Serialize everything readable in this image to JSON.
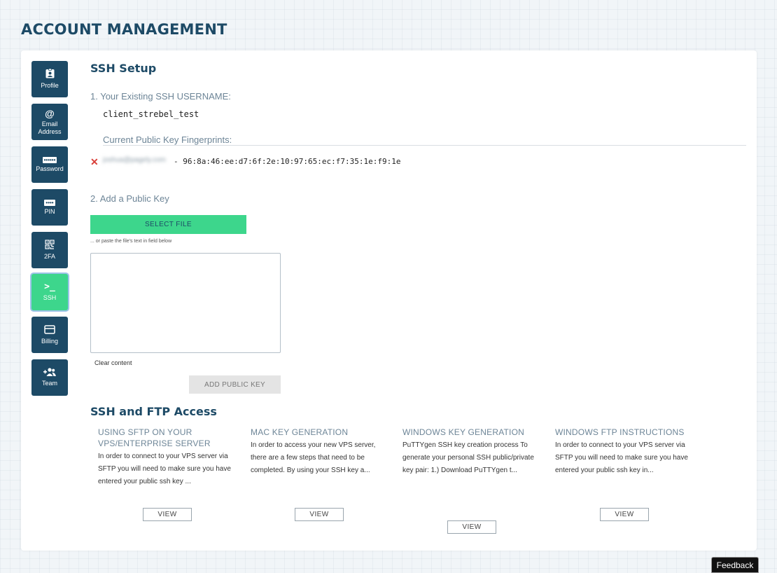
{
  "header": {
    "title": "ACCOUNT MANAGEMENT"
  },
  "sidebar": {
    "items": [
      {
        "id": "profile",
        "label": "Profile",
        "icon": "id-badge-icon"
      },
      {
        "id": "email",
        "label": "Email Address",
        "icon": "at-icon"
      },
      {
        "id": "password",
        "label": "Password",
        "icon": "password-dots-icon"
      },
      {
        "id": "pin",
        "label": "PIN",
        "icon": "pin-dots-icon"
      },
      {
        "id": "2fa",
        "label": "2FA",
        "icon": "qr-code-icon"
      },
      {
        "id": "ssh",
        "label": "SSH",
        "icon": "terminal-prompt-icon",
        "active": true
      },
      {
        "id": "billing",
        "label": "Billing",
        "icon": "credit-card-icon"
      },
      {
        "id": "team",
        "label": "Team",
        "icon": "add-user-icon"
      }
    ],
    "glyphs": {
      "at": "@",
      "password": "••••••",
      "pin": "••••",
      "terminal": ">_",
      "team": "+👥"
    }
  },
  "ssh_setup": {
    "title": "SSH Setup",
    "username_label": "1. Your Existing SSH USERNAME:",
    "username": "client_strebel_test",
    "fingerprints_label": "Current Public Key Fingerprints:",
    "fingerprint": {
      "owner_redacted": "joshua@pagely.com",
      "value": "- 96:8a:46:ee:d7:6f:2e:10:97:65:ec:f7:35:1e:f9:1e",
      "remove_glyph": "✕"
    },
    "add_key_label": "2. Add a Public Key",
    "select_file_label": "SELECT FILE",
    "paste_hint": "... or paste the file's text in field below",
    "textarea_value": "",
    "clear_label": "Clear content",
    "add_key_button": "ADD PUBLIC KEY"
  },
  "access": {
    "title": "SSH and FTP Access",
    "view_label": "VIEW",
    "columns": [
      {
        "title": "USING SFTP ON YOUR VPS/ENTERPRISE SERVER",
        "body": "In order to connect to your VPS server via SFTP you will need to make sure you have entered your public ssh key ..."
      },
      {
        "title": "MAC KEY GENERATION",
        "body": "In order to access your new VPS server, there are a few steps that need to be completed. By using your SSH key a..."
      },
      {
        "title": "WINDOWS KEY GENERATION",
        "body": "PuTTYgen SSH key creation process To generate your personal SSH public/private key pair: 1.) Download PuTTYgen t..."
      },
      {
        "title": "WINDOWS FTP INSTRUCTIONS",
        "body": "In order to connect to your VPS server via SFTP you will need to make sure you have entered your public ssh key in..."
      }
    ]
  },
  "feedback_label": "Feedback",
  "colors": {
    "brand": "#1d4a66",
    "accent": "#3dd68c",
    "danger": "#d9403a"
  }
}
